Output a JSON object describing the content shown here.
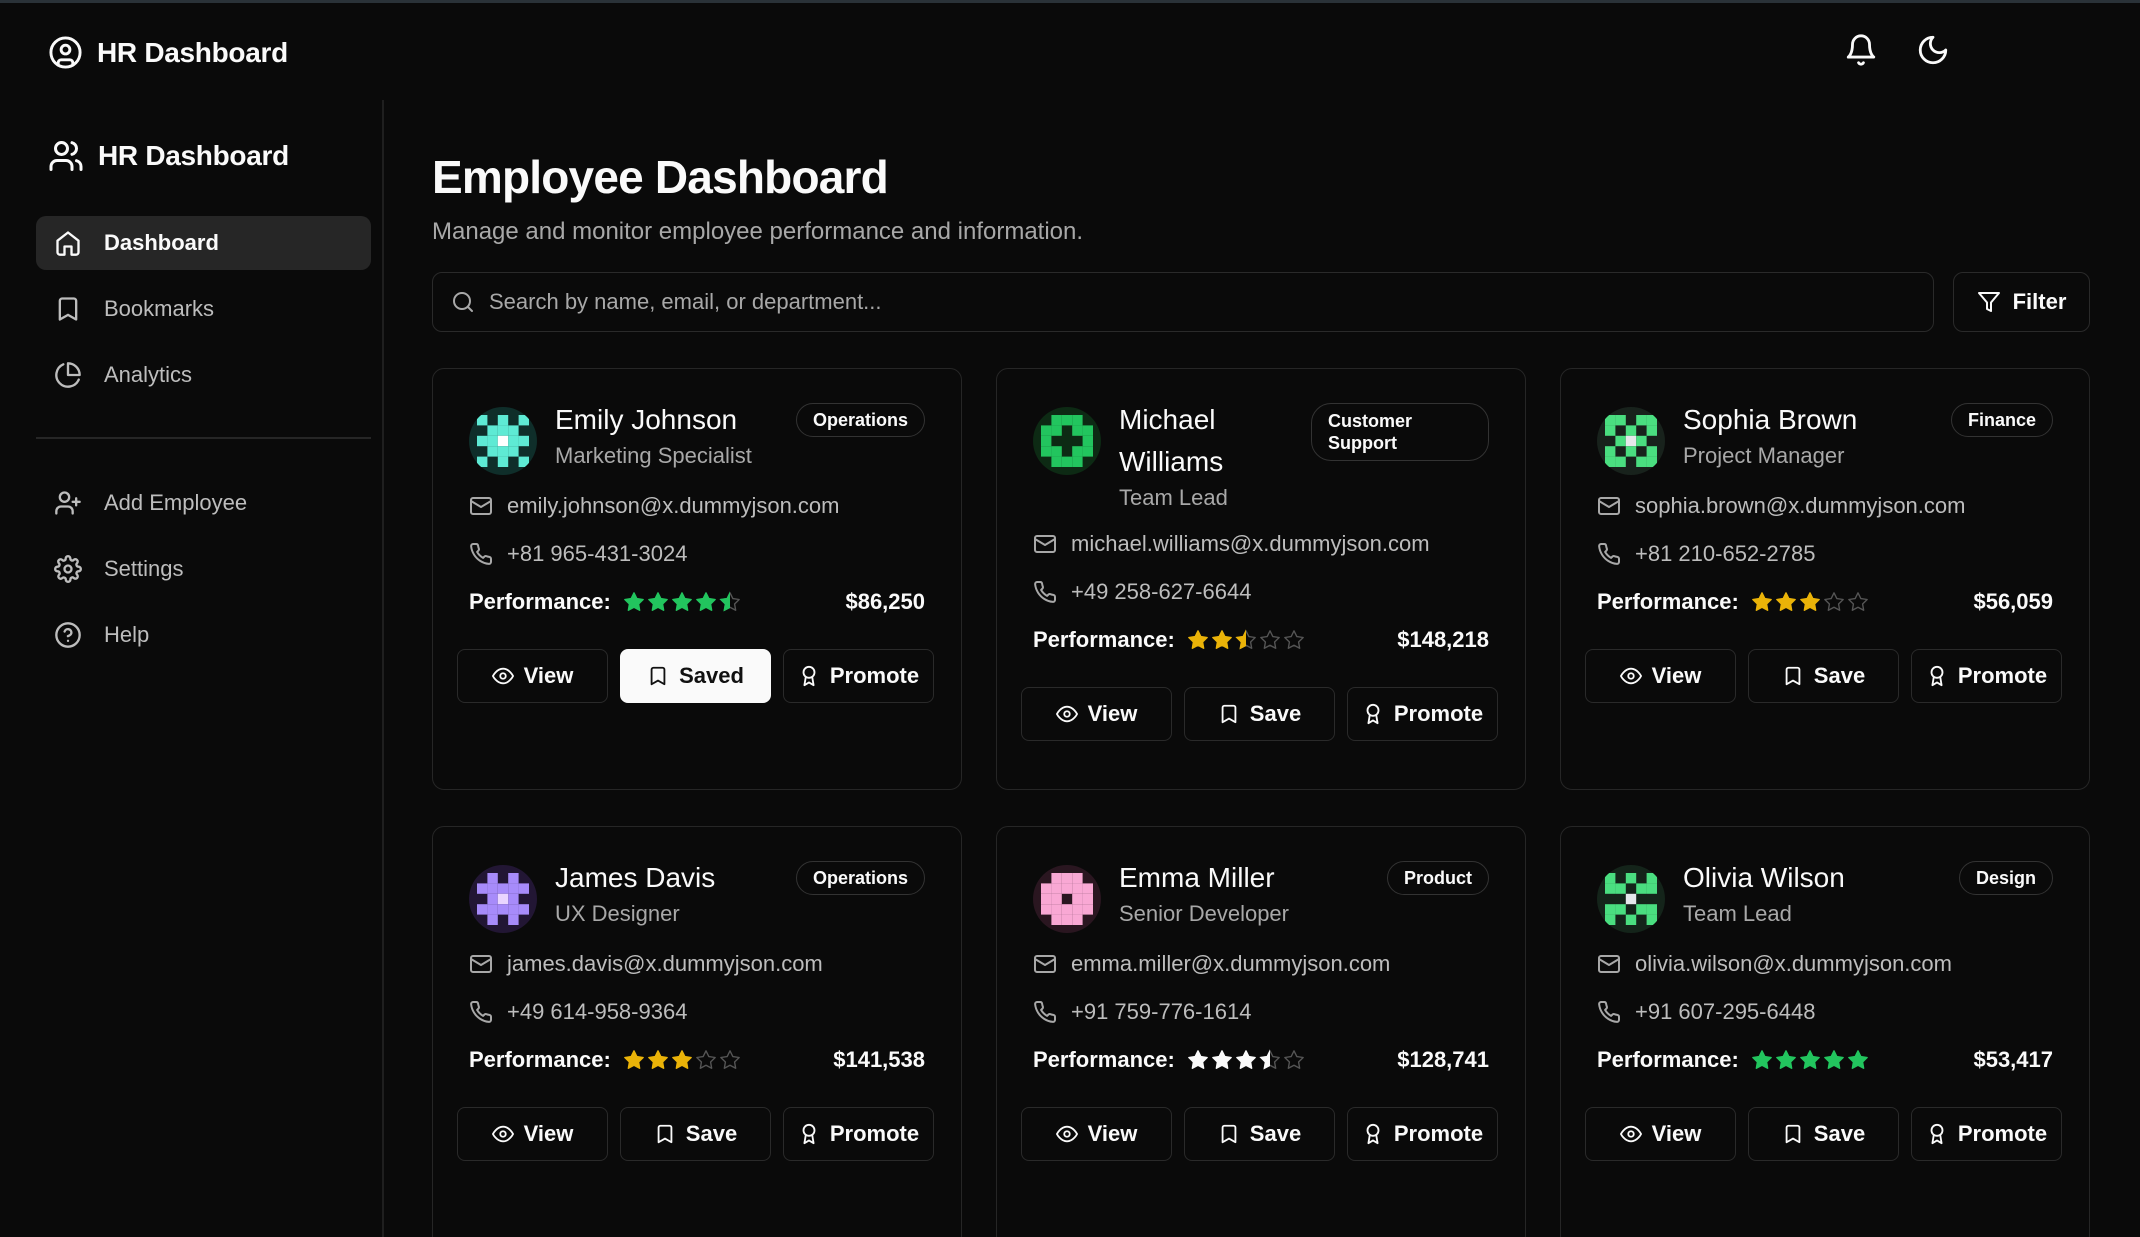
{
  "app": {
    "title": "HR Dashboard"
  },
  "topbar": {
    "notifications_icon": "bell-icon",
    "theme_icon": "moon-icon"
  },
  "sidebar": {
    "title": "HR Dashboard",
    "items": [
      {
        "label": "Dashboard",
        "icon": "home-icon",
        "active": true
      },
      {
        "label": "Bookmarks",
        "icon": "bookmark-icon"
      },
      {
        "label": "Analytics",
        "icon": "pie-chart-icon"
      }
    ],
    "secondary": [
      {
        "label": "Add Employee",
        "icon": "user-plus-icon"
      },
      {
        "label": "Settings",
        "icon": "gear-icon"
      },
      {
        "label": "Help",
        "icon": "help-circle-icon"
      }
    ]
  },
  "main": {
    "title": "Employee Dashboard",
    "subtitle": "Manage and monitor employee performance and information.",
    "search": {
      "placeholder": "Search by name, email, or department..."
    },
    "filter_label": "Filter"
  },
  "colors": {
    "background": "#0a0a0a",
    "star_green": "#22c55e",
    "star_yellow": "#eab308",
    "star_white": "#fafafa",
    "star_empty": "#555555"
  },
  "employees": [
    {
      "name": "Emily Johnson",
      "role": "Marketing Specialist",
      "department": "Operations",
      "email": "emily.johnson@x.dummyjson.com",
      "phone": "+81 965-431-3024",
      "performance_label": "Performance:",
      "rating": 4.5,
      "star_color": "#22c55e",
      "salary": "$86,250",
      "view_label": "View",
      "save_label": "Saved",
      "saved": true,
      "promote_label": "Promote"
    },
    {
      "name": "Michael Williams",
      "role": "Team Lead",
      "department": "Customer Support",
      "email": "michael.williams@x.dummyjson.com",
      "phone": "+49 258-627-6644",
      "performance_label": "Performance:",
      "rating": 2.5,
      "star_color": "#eab308",
      "salary": "$148,218",
      "view_label": "View",
      "save_label": "Save",
      "saved": false,
      "promote_label": "Promote"
    },
    {
      "name": "Sophia Brown",
      "role": "Project Manager",
      "department": "Finance",
      "email": "sophia.brown@x.dummyjson.com",
      "phone": "+81 210-652-2785",
      "performance_label": "Performance:",
      "rating": 3,
      "star_color": "#eab308",
      "salary": "$56,059",
      "view_label": "View",
      "save_label": "Save",
      "saved": false,
      "promote_label": "Promote"
    },
    {
      "name": "James Davis",
      "role": "UX Designer",
      "department": "Operations",
      "email": "james.davis@x.dummyjson.com",
      "phone": "+49 614-958-9364",
      "performance_label": "Performance:",
      "rating": 3,
      "star_color": "#eab308",
      "salary": "$141,538",
      "view_label": "View",
      "save_label": "Save",
      "saved": false,
      "promote_label": "Promote"
    },
    {
      "name": "Emma Miller",
      "role": "Senior Developer",
      "department": "Product",
      "email": "emma.miller@x.dummyjson.com",
      "phone": "+91 759-776-1614",
      "performance_label": "Performance:",
      "rating": 3.5,
      "star_color": "#fafafa",
      "salary": "$128,741",
      "view_label": "View",
      "save_label": "Save",
      "saved": false,
      "promote_label": "Promote"
    },
    {
      "name": "Olivia Wilson",
      "role": "Team Lead",
      "department": "Design",
      "email": "olivia.wilson@x.dummyjson.com",
      "phone": "+91 607-295-6448",
      "performance_label": "Performance:",
      "rating": 5,
      "star_color": "#22c55e",
      "salary": "$53,417",
      "view_label": "View",
      "save_label": "Save",
      "saved": false,
      "promote_label": "Promote"
    }
  ]
}
